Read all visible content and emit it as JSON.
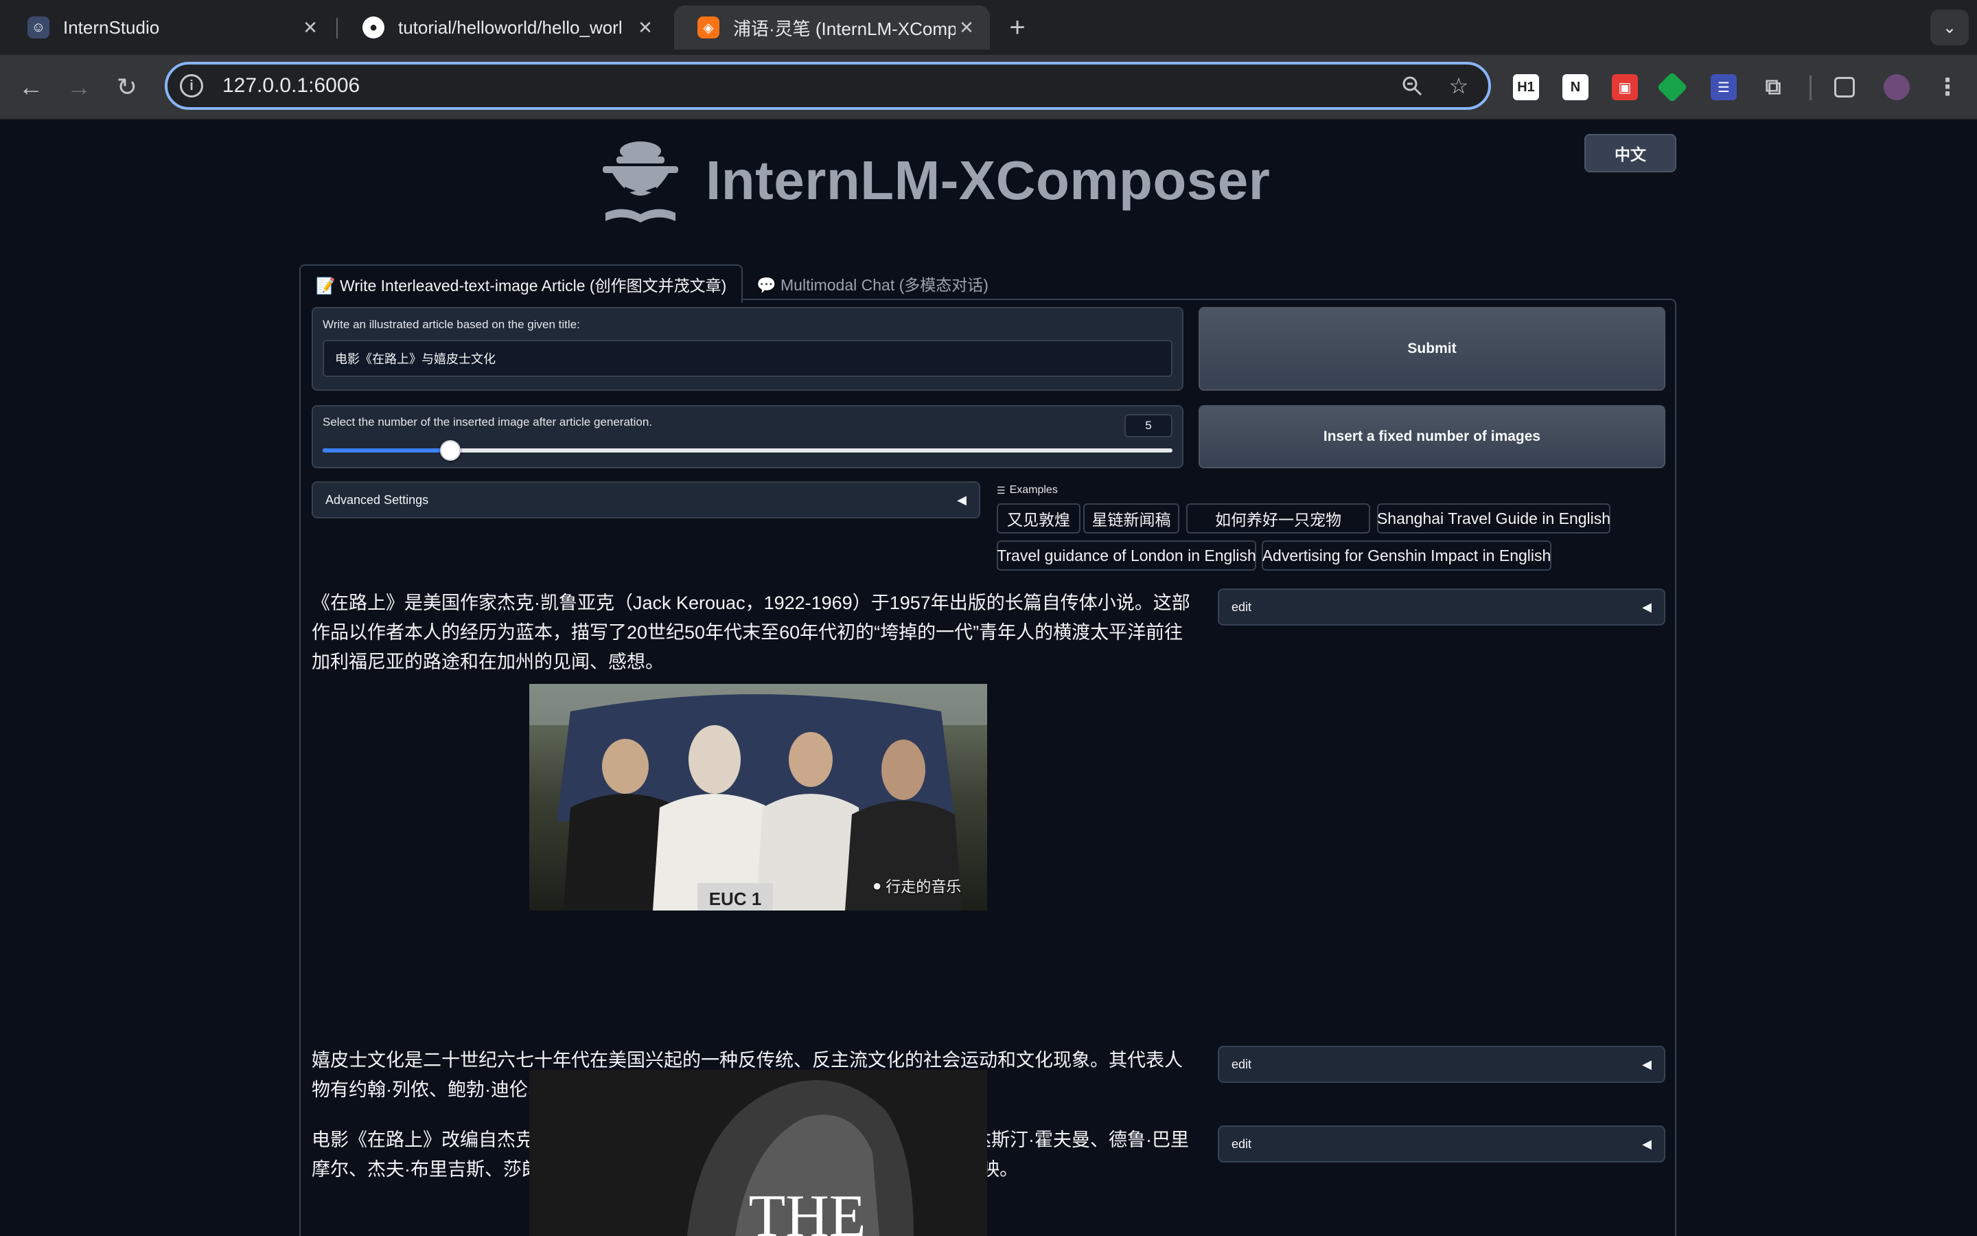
{
  "browser": {
    "tabs": [
      {
        "title": "InternStudio",
        "active": false
      },
      {
        "title": "tutorial/helloworld/hello_worl",
        "active": false
      },
      {
        "title": "浦语·灵笔 (InternLM-XCompo",
        "active": true
      }
    ],
    "new_tab_icon": "plus-icon",
    "url": "127.0.0.1:6006",
    "extensions": [
      "h1-extension-icon",
      "notion-extension-icon",
      "red-extension-icon",
      "green-extension-icon",
      "blue-extension-icon",
      "puzzle-icon"
    ]
  },
  "header": {
    "app_title": "InternLM-XComposer",
    "language_button": "中文"
  },
  "tabs": {
    "write_article": "📝 Write Interleaved-text-image Article (创作图文并茂文章)",
    "multimodal_chat": "💬 Multimodal Chat (多模态对话)"
  },
  "article_form": {
    "title_label": "Write an illustrated article based on the given title:",
    "title_value": "电影《在路上》与嬉皮士文化",
    "submit_label": "Submit",
    "image_count_label": "Select the number of the inserted image after article generation.",
    "image_count_value": "5",
    "slider_fraction": 0.15,
    "insert_button_label": "Insert a fixed number of images",
    "advanced_settings_label": "Advanced Settings"
  },
  "examples": {
    "heading": "Examples",
    "items": [
      "又见敦煌",
      "星链新闻稿",
      "如何养好一只宠物",
      "Shanghai Travel Guide in English",
      "Travel guidance of London in English",
      "Advertising for Genshin Impact in English"
    ]
  },
  "article": {
    "paragraphs": [
      "《在路上》是美国作家杰克·凯鲁亚克（Jack Kerouac，1922-1969）于1957年出版的长篇自传体小说。这部作品以作者本人的经历为蓝本，描写了20世纪50年代末至60年代初的“垮掉的一代”青年人的横渡太平洋前往加利福尼亚的路途和在加州的见闻、感想。",
      "嬉皮士文化是二十世纪六七十年代在美国兴起的一种反传统、反主流文化的社会运动和文化现象。其代表人物有约翰·列侬、鲍勃·迪伦、吉米·亨德里克斯、伍德斯托克音乐节等。",
      "电影《在路上》改编自杰克·凯鲁亚克的同名小说，由美国导演柯蒂斯·汉森执导，达斯汀·霍夫曼、德鲁·巴里摩尔、杰夫·布里吉斯、莎朗·斯通等人联袂出演。该片于2006年10月13日在美国上映。"
    ],
    "edit_label": "edit",
    "photo1_watermark": "行走的音乐",
    "photo1_plate": "EUC 1",
    "photo2_text": "THE"
  }
}
